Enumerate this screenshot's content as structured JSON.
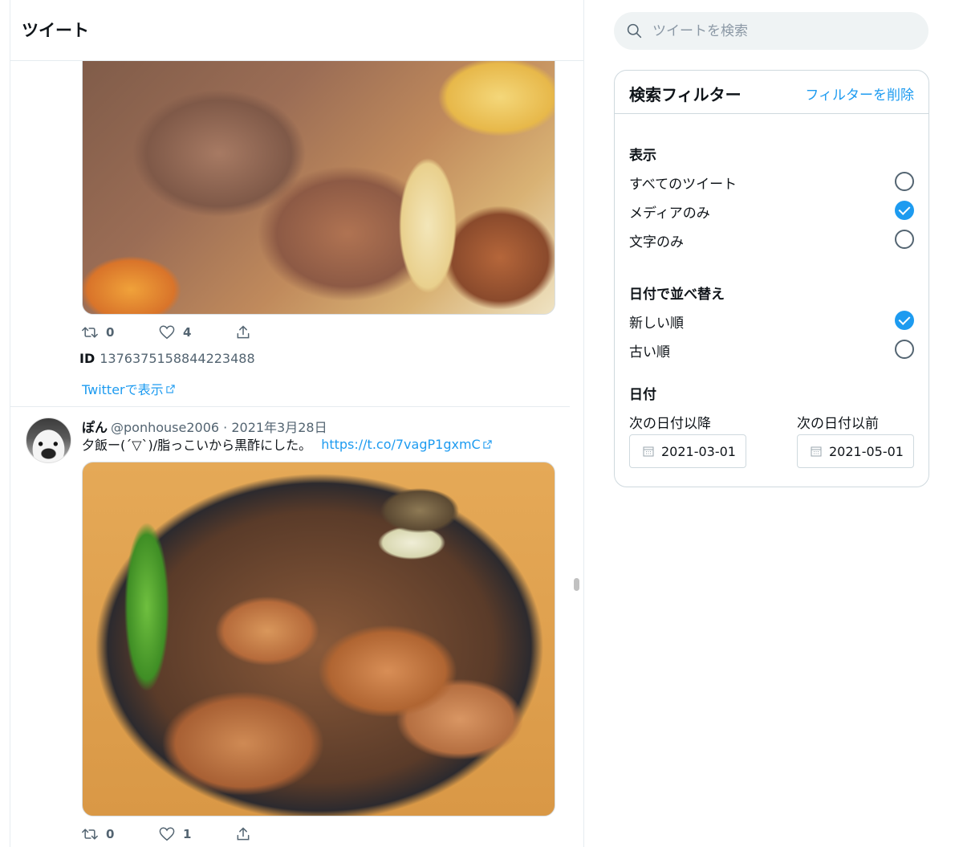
{
  "timeline": {
    "title": "ツイート",
    "tweets": [
      {
        "retweets": "0",
        "likes": "4",
        "id_label": "ID",
        "id_value": "1376375158844223488",
        "view_link": "Twitterで表示"
      },
      {
        "author": "ぽん",
        "handle": "@ponhouse2006 · 2021年3月28日",
        "text": "夕飯ー(´▽`)/脂っこいから黒酢にした。",
        "url": "https://t.co/7vagP1gxmC",
        "retweets": "0",
        "likes": "1"
      }
    ]
  },
  "search": {
    "placeholder": "ツイートを検索"
  },
  "filter": {
    "title": "検索フィルター",
    "clear_label": "フィルターを削除",
    "show_section": "表示",
    "show_options": [
      "すべてのツイート",
      "メディアのみ",
      "文字のみ"
    ],
    "show_selected": "メディアのみ",
    "sort_section": "日付で並べ替え",
    "sort_options": [
      "新しい順",
      "古い順"
    ],
    "sort_selected": "新しい順",
    "date_section": "日付",
    "since_label": "次の日付以降",
    "since_value": "2021-03-01",
    "until_label": "次の日付以前",
    "until_value": "2021-05-01"
  },
  "icons": {
    "retweet": "retweet-icon",
    "like": "heart-icon",
    "share": "share-icon",
    "search": "search-icon",
    "calendar": "calendar-icon",
    "external": "external-link-icon"
  },
  "colors": {
    "accent": "#1d9bf0",
    "text": "#0f1419",
    "muted": "#536471",
    "border": "#cfd9de"
  }
}
